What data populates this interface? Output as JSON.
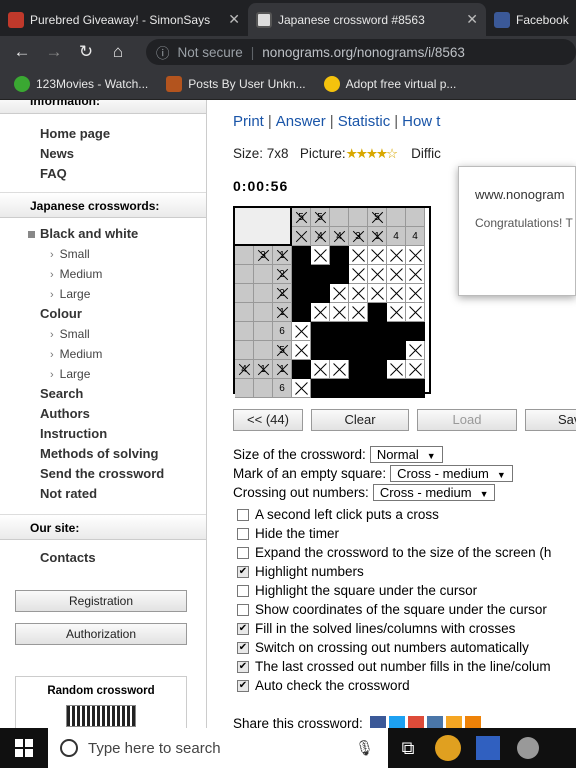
{
  "tabs": [
    {
      "title": "Purebred Giveaway! - SimonSays",
      "active": false
    },
    {
      "title": "Japanese crossword #8563",
      "active": true
    },
    {
      "title": "Facebook",
      "active": false
    }
  ],
  "nav": {
    "security": "Not secure",
    "url": "nonograms.org/nonograms/i/8563"
  },
  "bookmarks": [
    "123Movies - Watch...",
    "Posts By User Unkn...",
    "Adopt free virtual p..."
  ],
  "sidebar": {
    "info_head": "Information:",
    "info_items": [
      "Home page",
      "News",
      "FAQ"
    ],
    "jc_head": "Japanese crosswords:",
    "bw": "Black and white",
    "bw_sub": [
      "Small",
      "Medium",
      "Large"
    ],
    "colour": "Colour",
    "colour_sub": [
      "Small",
      "Medium",
      "Large"
    ],
    "more": [
      "Search",
      "Authors",
      "Instruction",
      "Methods of solving",
      "Send the crossword",
      "Not rated"
    ],
    "site_head": "Our site:",
    "contacts": "Contacts",
    "registration": "Registration",
    "authorization": "Authorization",
    "random": "Random crossword"
  },
  "links": [
    "Print",
    "Answer",
    "Statistic",
    "How t"
  ],
  "info": {
    "size_label": "Size:",
    "size": "7x8",
    "picture_label": "Picture:",
    "stars": "★★★★☆",
    "difficulty_label": "Diffic"
  },
  "timer": "0:00:56",
  "puzzle": {
    "top_clues": [
      [
        "5",
        "",
        "5",
        ""
      ],
      [
        "4",
        "4",
        "3",
        "1"
      ]
    ],
    "top_clues_extra": [
      "4",
      "4"
    ],
    "left_clues": [
      [
        "",
        "3",
        "1"
      ],
      [
        "",
        "",
        "2"
      ],
      [
        "",
        "",
        "2"
      ],
      [
        "",
        "",
        "1"
      ],
      [
        "",
        "",
        "6"
      ],
      [
        "",
        "",
        "5"
      ],
      [
        "4",
        "1",
        "1"
      ],
      [
        "",
        "",
        "6"
      ]
    ],
    "rows": [
      "FXFXXXX",
      "FFFXXXX",
      "FFXXXXX",
      "FXXXFXX",
      "XFFFFFF",
      "XFFFFFX",
      "FXXFFXX",
      "XFFFFFF"
    ]
  },
  "buttons": {
    "back": "<< (44)",
    "clear": "Clear",
    "load": "Load",
    "save": "Sav"
  },
  "options": {
    "size_label": "Size of the crossword:",
    "size_val": "Normal",
    "mark_label": "Mark of an empty square:",
    "mark_val": "Cross - medium",
    "num_label": "Crossing out numbers:",
    "num_val": "Cross - medium"
  },
  "checks": [
    {
      "label": "A second left click puts a cross",
      "on": false
    },
    {
      "label": "Hide the timer",
      "on": false
    },
    {
      "label": "Expand the crossword to the size of the screen (h",
      "on": false
    },
    {
      "label": "Highlight numbers",
      "on": true
    },
    {
      "label": "Highlight the square under the cursor",
      "on": false
    },
    {
      "label": "Show coordinates of the square under the cursor",
      "on": false
    },
    {
      "label": "Fill in the solved lines/columns with crosses",
      "on": true
    },
    {
      "label": "Switch on crossing out numbers automatically",
      "on": true
    },
    {
      "label": "The last crossed out number fills in the line/colum",
      "on": true
    },
    {
      "label": "Auto check the crossword",
      "on": true
    }
  ],
  "share_label": "Share this crossword:",
  "popup": {
    "title": "www.nonogram",
    "text": "Congratulations! T"
  },
  "taskbar": {
    "search_placeholder": "Type here to search"
  },
  "colors": {
    "link": "#1a55a8",
    "chrome_dark": "#202124",
    "chrome_bar": "#35363a"
  }
}
